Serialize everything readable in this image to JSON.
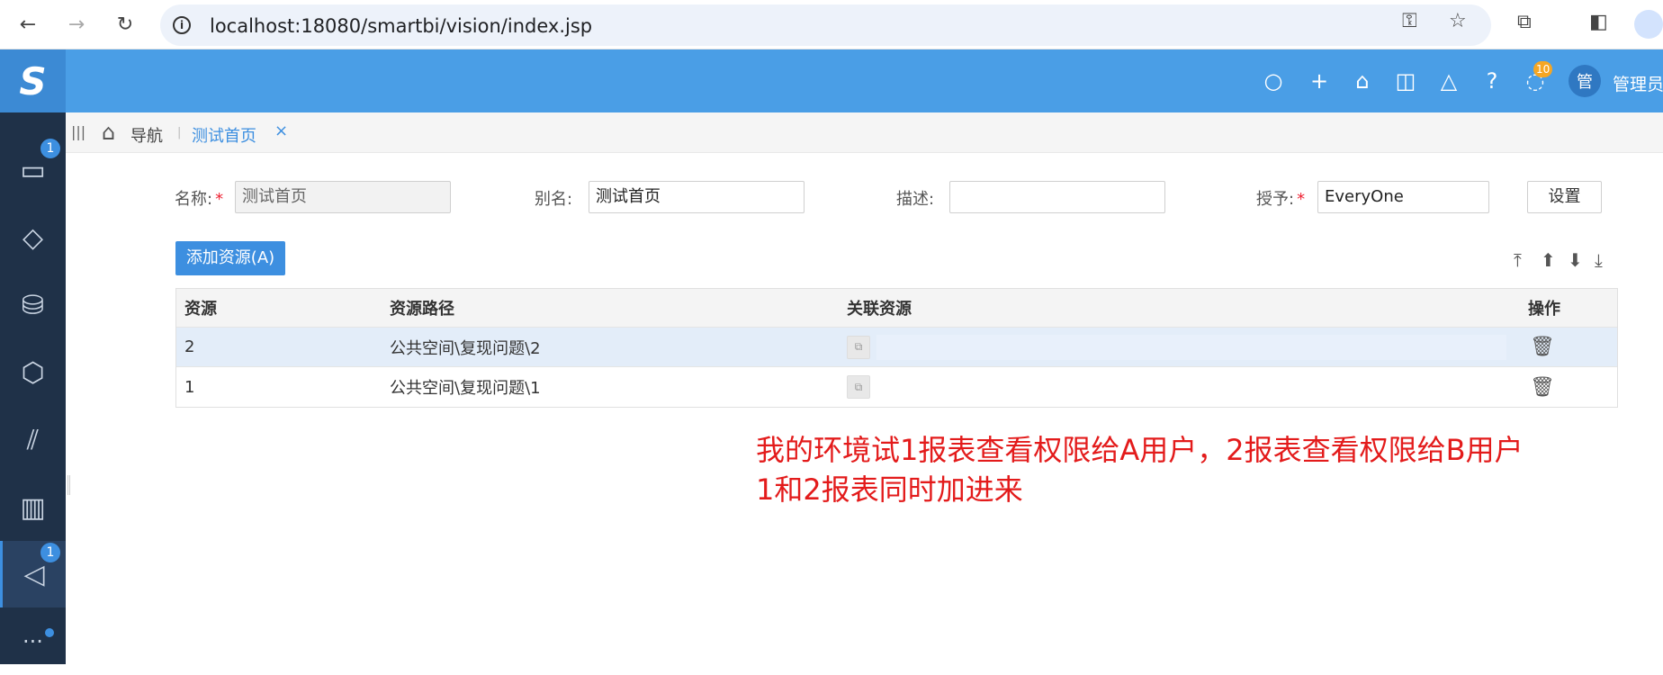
{
  "browser": {
    "url": "localhost:18080/smartbi/vision/index.jsp",
    "back": "←",
    "forward": "→",
    "reload": "↻"
  },
  "header": {
    "logo": "S",
    "message_count": "10",
    "avatar_text": "管",
    "user_name": "管理员"
  },
  "sidebar": {
    "items": [
      {
        "icon": "monitor-icon",
        "badge": "1"
      },
      {
        "icon": "apps-icon"
      },
      {
        "icon": "data-settings-icon"
      },
      {
        "icon": "cube-icon"
      },
      {
        "icon": "layers-icon"
      },
      {
        "icon": "bar-chart-icon"
      },
      {
        "icon": "send-icon",
        "badge": "1"
      },
      {
        "icon": "more-icon"
      }
    ]
  },
  "tabbar": {
    "nav_label": "导航",
    "active_tab": "测试首页",
    "close": "×"
  },
  "form": {
    "name_label": "名称:",
    "name_value": "测试首页",
    "alias_label": "别名:",
    "alias_value": "测试首页",
    "desc_label": "描述:",
    "desc_value": "",
    "grant_label": "授予:",
    "grant_value": "EveryOne",
    "set_button": "设置",
    "required_mark": "*"
  },
  "toolbar": {
    "add_resource": "添加资源(A)"
  },
  "table": {
    "columns": [
      "资源",
      "资源路径",
      "关联资源",
      "操作"
    ],
    "rows": [
      {
        "resource": "2",
        "path": "公共空间\\复现问题\\2",
        "selected": true
      },
      {
        "resource": "1",
        "path": "公共空间\\复现问题\\1",
        "selected": false
      }
    ]
  },
  "annotation": {
    "line1": "我的环境试1报表查看权限给A用户，2报表查看权限给B用户",
    "line2": "1和2报表同时加进来"
  }
}
